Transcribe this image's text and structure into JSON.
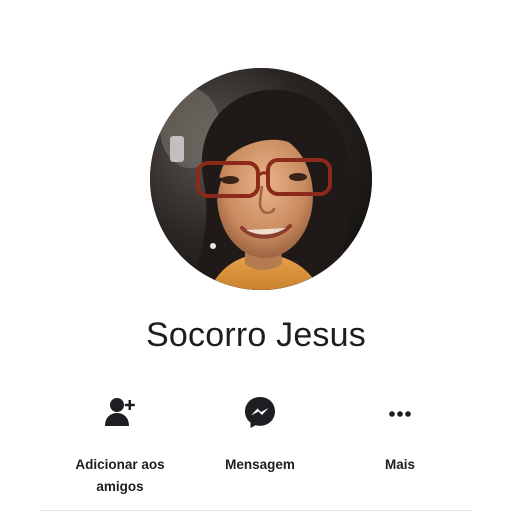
{
  "profile": {
    "name": "Socorro Jesus"
  },
  "actions": [
    {
      "icon": "add-friend-icon",
      "label": "Adicionar aos amigos"
    },
    {
      "icon": "messenger-icon",
      "label": "Mensagem"
    },
    {
      "icon": "more-icon",
      "label": "Mais"
    }
  ],
  "colors": {
    "text": "#1c1e21",
    "background": "#ffffff",
    "icon": "#1c1e21"
  }
}
